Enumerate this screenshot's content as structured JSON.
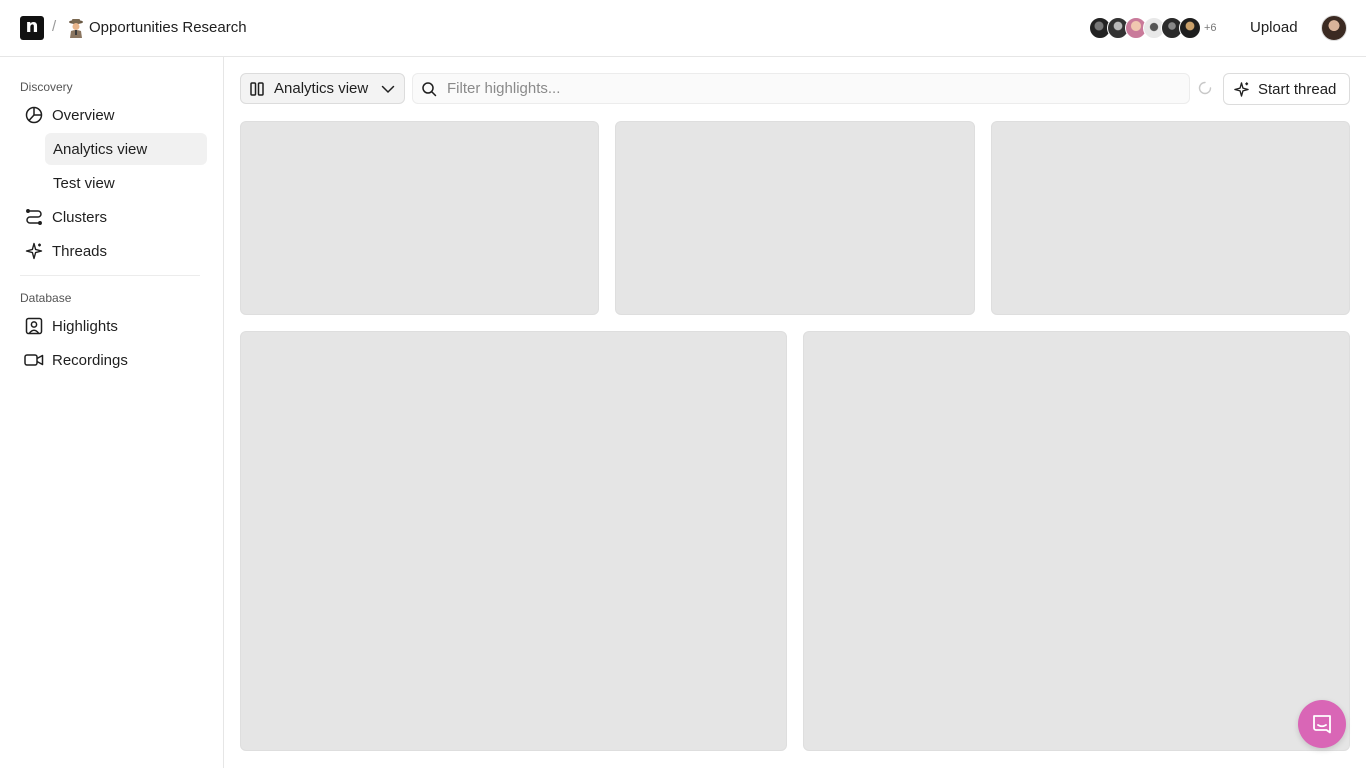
{
  "header": {
    "logo_letter": "n",
    "separator": "/",
    "project_title": "Opportunities Research",
    "collaborators_more": "+6",
    "upload_label": "Upload"
  },
  "sidebar": {
    "discovery_label": "Discovery",
    "overview_label": "Overview",
    "views": [
      {
        "label": "Analytics view",
        "active": true
      },
      {
        "label": "Test view",
        "active": false
      }
    ],
    "clusters_label": "Clusters",
    "threads_label": "Threads",
    "database_label": "Database",
    "highlights_label": "Highlights",
    "recordings_label": "Recordings"
  },
  "toolbar": {
    "view_select": "Analytics view",
    "filter_placeholder": "Filter highlights...",
    "filter_value": "",
    "start_thread_label": "Start thread"
  },
  "colors": {
    "skeleton": "#e5e5e5",
    "chat_bubble": "#d966b6",
    "active_nav": "#f1f1f1"
  },
  "icons": {
    "collaborators": [
      "avatar",
      "avatar",
      "avatar",
      "avatar",
      "avatar",
      "avatar"
    ],
    "chat": "chat-bubble-icon"
  }
}
